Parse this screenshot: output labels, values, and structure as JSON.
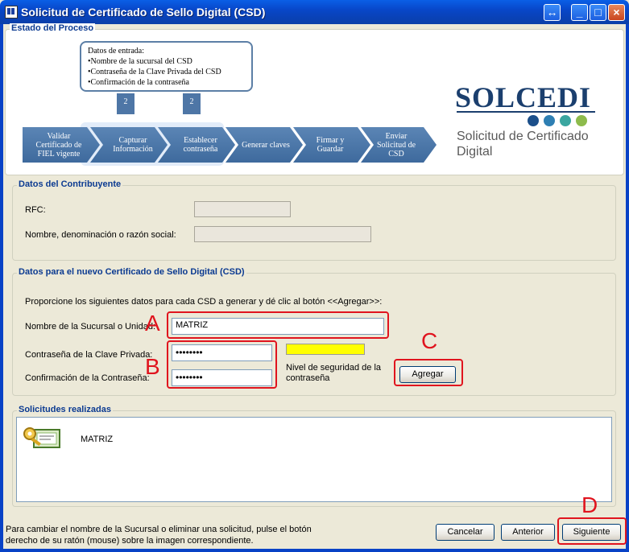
{
  "window": {
    "title": "Solicitud de Certificado de Sello Digital (CSD)"
  },
  "titlebar_buttons": {
    "restore": "↔",
    "minimize": "_",
    "maximize": "□",
    "close": "×"
  },
  "process": {
    "group_label": "Estado del Proceso",
    "callout": {
      "heading": "Datos de entrada:",
      "items": [
        "•Nombre de la sucursal del CSD",
        "•Contraseña de la Clave Privada del CSD",
        "•Confirmación de la contraseña"
      ]
    },
    "badges": [
      "2",
      "2"
    ],
    "steps": [
      "Validar Certificado de FIEL vigente",
      "Capturar Información",
      "Establecer contraseña",
      "Generar claves",
      "Firmar y Guardar",
      "Enviar Solicitud de CSD"
    ],
    "logo": {
      "title": "SOLCEDI",
      "subtitle_line1": "Solicitud de Certificado",
      "subtitle_line2": "Digital",
      "dot_colors": [
        "#1B4F8A",
        "#2E7FB3",
        "#3AA6A0",
        "#8DBB4C",
        "#B9C96B"
      ]
    }
  },
  "contribuyente": {
    "group_label": "Datos del Contribuyente",
    "rfc_label": "RFC:",
    "rfc_value": "",
    "nombre_label": "Nombre, denominación o razón social:",
    "nombre_value": ""
  },
  "csd": {
    "group_label": "Datos para el nuevo Certificado de Sello Digital (CSD)",
    "instructions": "Proporcione los siguientes datos para cada CSD a generar y dé clic al botón <<Agregar>>:",
    "sucursal_label": "Nombre de la Sucursal o Unidad:",
    "sucursal_value": "MATRIZ",
    "password_label": "Contraseña de la Clave Privada:",
    "password_value": "••••••••",
    "confirm_label": "Confirmación de la Contraseña:",
    "confirm_value": "••••••••",
    "security_label": "Nivel de seguridad de la contraseña",
    "security_level_color": "#FFFF00",
    "agregar_button": "Agregar"
  },
  "solicitudes": {
    "group_label": "Solicitudes realizadas",
    "items": [
      {
        "label": "MATRIZ",
        "icon": "certificate-icon"
      }
    ]
  },
  "footer": {
    "hint": "Para cambiar el nombre de la Sucursal o eliminar una solicitud, pulse el botón derecho de su ratón (mouse) sobre la imagen correspondiente.",
    "cancel_button": "Cancelar",
    "back_button": "Anterior",
    "next_button": "Siguiente"
  },
  "annotations": {
    "A": "A",
    "B": "B",
    "C": "C",
    "D": "D"
  }
}
